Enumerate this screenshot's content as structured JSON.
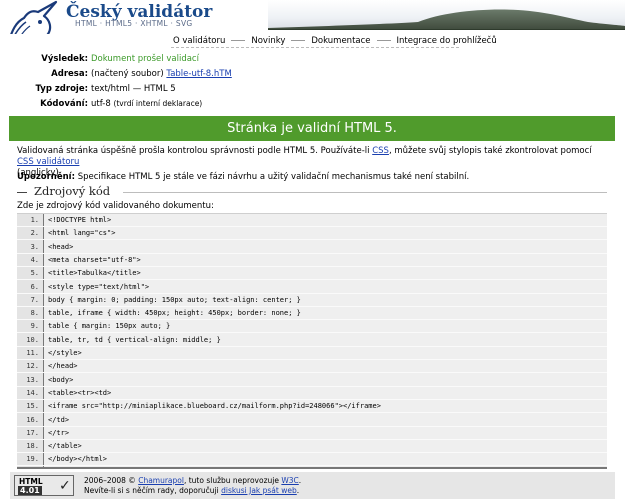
{
  "header": {
    "title": "Český validátor",
    "subtitle": "HTML · HTML5 · XHTML · SVG"
  },
  "nav": [
    {
      "label": "O validátoru"
    },
    {
      "label": "Novinky"
    },
    {
      "label": "Dokumentace"
    },
    {
      "label": "Integrace do prohlížečů"
    }
  ],
  "info": {
    "result_label": "Výsledek:",
    "result_value": "Dokument prošel validací",
    "address_label": "Adresa:",
    "address_prefix": "(načtený soubor)",
    "address_link": "Table-utf-8.hTM",
    "type_label": "Typ zdroje:",
    "type_value": "text/html — HTML 5",
    "encoding_label": "Kódování:",
    "encoding_value": "utf-8",
    "encoding_note": "(tvrdí interní deklarace)"
  },
  "result_banner": "Stránka je validní HTML 5.",
  "valid_text": {
    "part1": "Validovaná stránka úspěšně prošla kontrolou správnosti podle HTML 5. Používáte-li ",
    "css_link": "CSS",
    "part2": ", můžete svůj stylopis také zkontrolovat pomocí ",
    "css_validator_link": "CSS validátoru",
    "part3": "(anglicky)."
  },
  "warning": {
    "label": "Upozornění:",
    "text": "Specifikace HTML 5 je stále ve fázi návrhu a užitý validační mechanismus také není stabilní."
  },
  "source": {
    "heading": "Zdrojový kód",
    "intro": "Zde je zdrojový kód validovaného dokumentu:",
    "lines": [
      {
        "num": "1.",
        "code": "<!DOCTYPE html>"
      },
      {
        "num": "2.",
        "code": "<html lang=\"cs\">"
      },
      {
        "num": "3.",
        "code": "<head>"
      },
      {
        "num": "4.",
        "code": "<meta charset=\"utf-8\">"
      },
      {
        "num": "5.",
        "code": "<title>Tabulka</title>"
      },
      {
        "num": "6.",
        "code": "<style type=\"text/html\">"
      },
      {
        "num": "7.",
        "code": "body { margin: 0; padding: 150px auto; text-align: center; }"
      },
      {
        "num": "8.",
        "code": "table, iframe { width: 450px; height: 450px; border: none; }"
      },
      {
        "num": "9.",
        "code": "table { margin: 150px auto; }"
      },
      {
        "num": "10.",
        "code": "table, tr, td { vertical-align: middle; }"
      },
      {
        "num": "11.",
        "code": "</style>"
      },
      {
        "num": "12.",
        "code": "</head>"
      },
      {
        "num": "13.",
        "code": "<body>"
      },
      {
        "num": "14.",
        "code": "<table><tr><td>"
      },
      {
        "num": "15.",
        "code": "<iframe src=\"http://miniaplikace.blueboard.cz/mailform.php?id=248066\"></iframe>"
      },
      {
        "num": "16.",
        "code": "</td>"
      },
      {
        "num": "17.",
        "code": "</tr>"
      },
      {
        "num": "18.",
        "code": "</table>"
      },
      {
        "num": "19.",
        "code": "</body></html>"
      }
    ]
  },
  "footer": {
    "badge_html": "HTML",
    "badge_version": "4.01",
    "line1_pre": "2006–2008 © ",
    "author_link": "Chamurapol",
    "line1_mid": ", tuto službu neprovozuje ",
    "w3c_link": "W3C",
    "line1_end": ".",
    "line2_pre": "Nevíte-li si s něčím rady, doporučuji ",
    "discussion_link": "diskusi Jak psát web",
    "line2_end": "."
  },
  "colors": {
    "result_green": "#509b2c",
    "link_blue": "#1a3fb0",
    "ok_green": "#3c9a2a",
    "title_blue": "#1a4a8a"
  }
}
